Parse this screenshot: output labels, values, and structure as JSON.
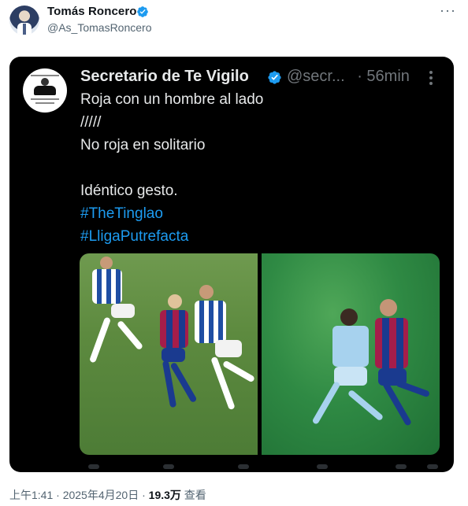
{
  "author": {
    "name": "Tomás Roncero",
    "handle": "@As_TomasRoncero"
  },
  "quoted": {
    "name": "Secretario de Te Vigilo",
    "handle": "@secr...",
    "time": "· 56min",
    "lines": [
      "Roja con un hombre al lado",
      "/////",
      "No roja en solitario",
      "Idéntico gesto."
    ],
    "hashtags": [
      "#TheTinglao",
      "#LligaPutrefacta"
    ]
  },
  "meta": {
    "time": "上午1:41",
    "sep1": " · ",
    "date": "2025年4月20日",
    "sep2": " · ",
    "views_count": "19.3万",
    "views_label": " 查看"
  },
  "colors": {
    "verified": "#1d9bf0",
    "link": "#1d9bf0",
    "card_bg": "#000000"
  },
  "icons": {
    "more": "more-horizontal-icon",
    "verified": "verified-badge-icon",
    "inner_more": "more-vertical-icon"
  }
}
